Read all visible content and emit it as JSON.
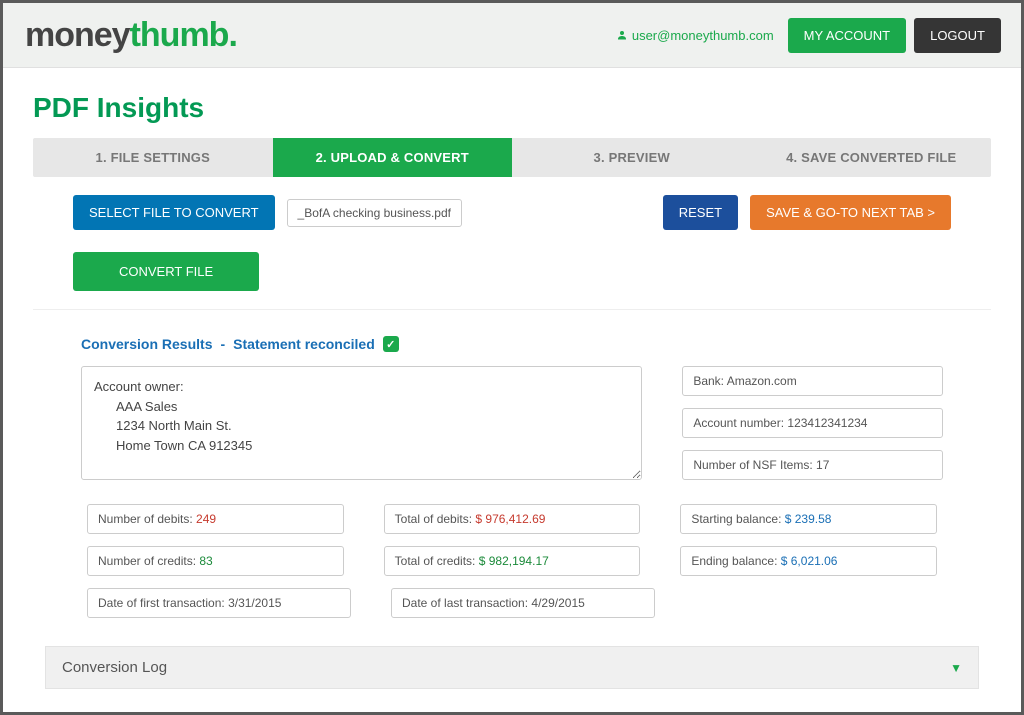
{
  "brand": {
    "part1": "money",
    "part2": "thumb",
    "dot": "."
  },
  "header": {
    "user_email": "user@moneythumb.com",
    "my_account": "MY ACCOUNT",
    "logout": "LOGOUT"
  },
  "page_title": "PDF Insights",
  "tabs": {
    "t1": "1. FILE SETTINGS",
    "t2": "2. UPLOAD & CONVERT",
    "t3": "3. PREVIEW",
    "t4": "4. SAVE CONVERTED FILE"
  },
  "actions": {
    "select_file": "SELECT FILE TO CONVERT",
    "filename": "_BofA checking business.pdf",
    "reset": "RESET",
    "save_next": "SAVE & GO-TO NEXT TAB >",
    "convert": "CONVERT FILE"
  },
  "results": {
    "heading_left": "Conversion Results",
    "dash": "  -  ",
    "heading_right": "Statement reconciled",
    "owner_label": "Account owner:",
    "owner_name": "AAA Sales",
    "owner_street": "1234 North Main St.",
    "owner_city": "Home Town CA 912345",
    "bank_label": "Bank: ",
    "bank_value": "Amazon.com",
    "acct_label": "Account number: ",
    "acct_value": "123412341234",
    "nsf_label": "Number of NSF Items: ",
    "nsf_value": "17",
    "debits_n_label": "Number of debits: ",
    "debits_n_value": "249",
    "debits_t_label": "Total of debits: ",
    "debits_t_value": "$ 976,412.69",
    "start_bal_label": "Starting balance: ",
    "start_bal_value": "$ 239.58",
    "credits_n_label": "Number of credits: ",
    "credits_n_value": "83",
    "credits_t_label": "Total of credits: ",
    "credits_t_value": "$ 982,194.17",
    "end_bal_label": "Ending balance: ",
    "end_bal_value": "$ 6,021.06",
    "first_tx_label": "Date of first transaction: ",
    "first_tx_value": "3/31/2015",
    "last_tx_label": "Date of last transaction: ",
    "last_tx_value": "4/29/2015"
  },
  "log": {
    "title": "Conversion Log"
  }
}
